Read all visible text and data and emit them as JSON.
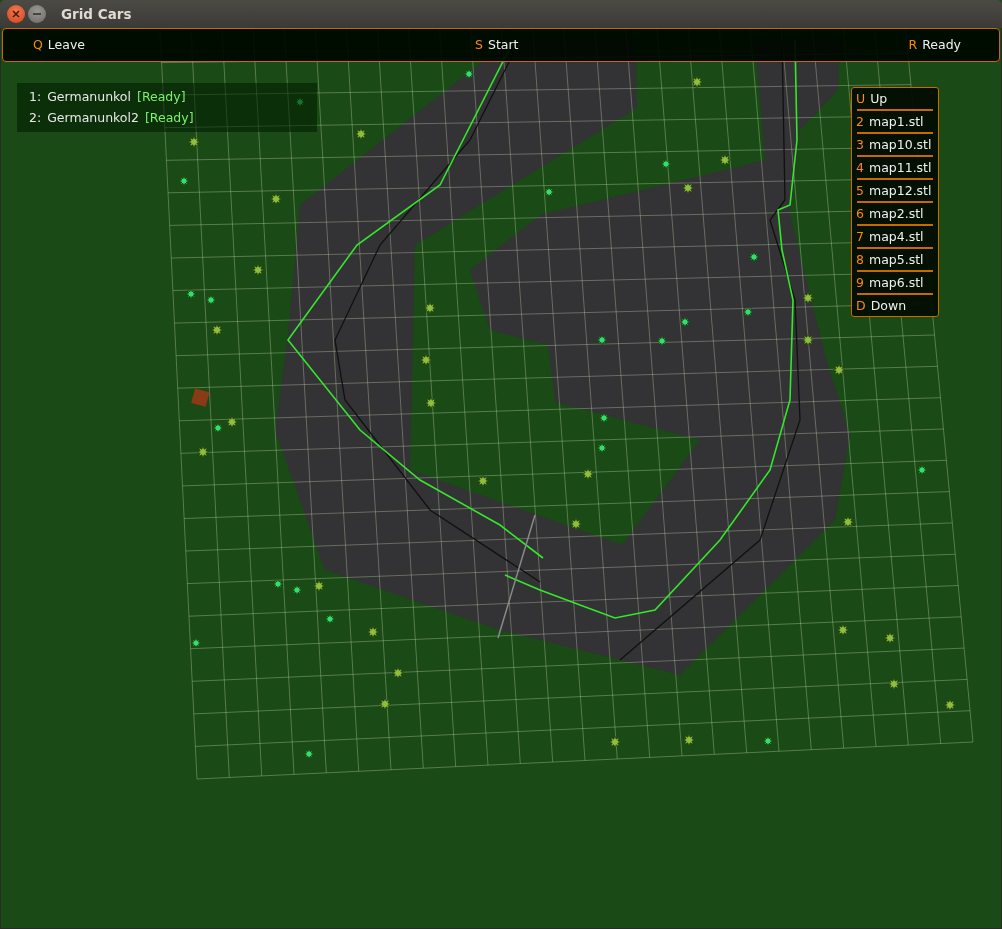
{
  "window": {
    "title": "Grid Cars"
  },
  "top_bar": [
    {
      "key": "Q",
      "label": "Leave"
    },
    {
      "key": "S",
      "label": "Start"
    },
    {
      "key": "R",
      "label": "Ready"
    }
  ],
  "players": [
    {
      "number": "1:",
      "name": "Germanunkol",
      "status": "[Ready]"
    },
    {
      "number": "2:",
      "name": "Germanunkol2",
      "status": "[Ready]"
    }
  ],
  "map_menu": [
    {
      "key": "U",
      "label": "Up"
    },
    {
      "key": "2",
      "label": "map1.stl"
    },
    {
      "key": "3",
      "label": "map10.stl"
    },
    {
      "key": "4",
      "label": "map11.stl"
    },
    {
      "key": "5",
      "label": "map12.stl"
    },
    {
      "key": "6",
      "label": "map2.stl"
    },
    {
      "key": "7",
      "label": "map4.stl"
    },
    {
      "key": "8",
      "label": "map5.stl"
    },
    {
      "key": "9",
      "label": "map6.stl"
    },
    {
      "key": "D",
      "label": "Down"
    }
  ]
}
